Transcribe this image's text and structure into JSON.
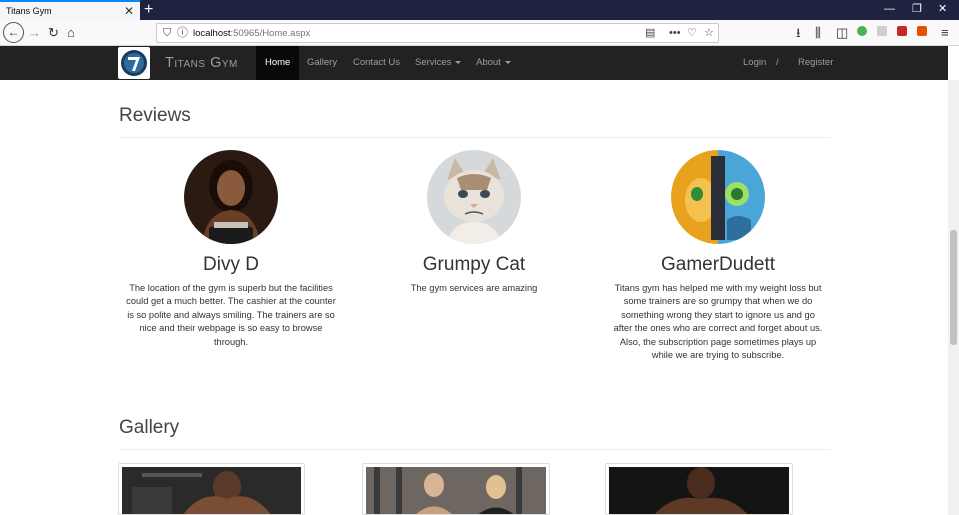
{
  "browser": {
    "tab_title": "Titans Gym",
    "url_host": "localhost",
    "url_rest": ":50965/Home.aspx"
  },
  "site": {
    "brand": "Titans Gym",
    "nav": {
      "home": "Home",
      "gallery": "Gallery",
      "contact": "Contact Us",
      "services": "Services",
      "about": "About",
      "login": "Login",
      "separator": "/",
      "register": "Register"
    }
  },
  "reviews": {
    "title": "Reviews",
    "items": [
      {
        "name": "Divy D",
        "text": "The location of the gym is superb but the facilities could get a much better. The cashier at the counter is so polite and always smiling. The trainers are so nice and their webpage is so easy to browse through."
      },
      {
        "name": "Grumpy Cat",
        "text": "The gym services are amazing"
      },
      {
        "name": "GamerDudett",
        "text": "Titans gym has helped me with my weight loss but some trainers are so grumpy that when we do something wrong they start to ignore us and go after the ones who are correct and forget about us. Also, the subscription page sometimes plays up while we are trying to subscribe."
      }
    ]
  },
  "gallery": {
    "title": "Gallery"
  },
  "colors": {
    "navbar": "#222222",
    "nav_active": "#080808",
    "nav_text": "#9d9d9d",
    "tabstrip": "#202340"
  }
}
